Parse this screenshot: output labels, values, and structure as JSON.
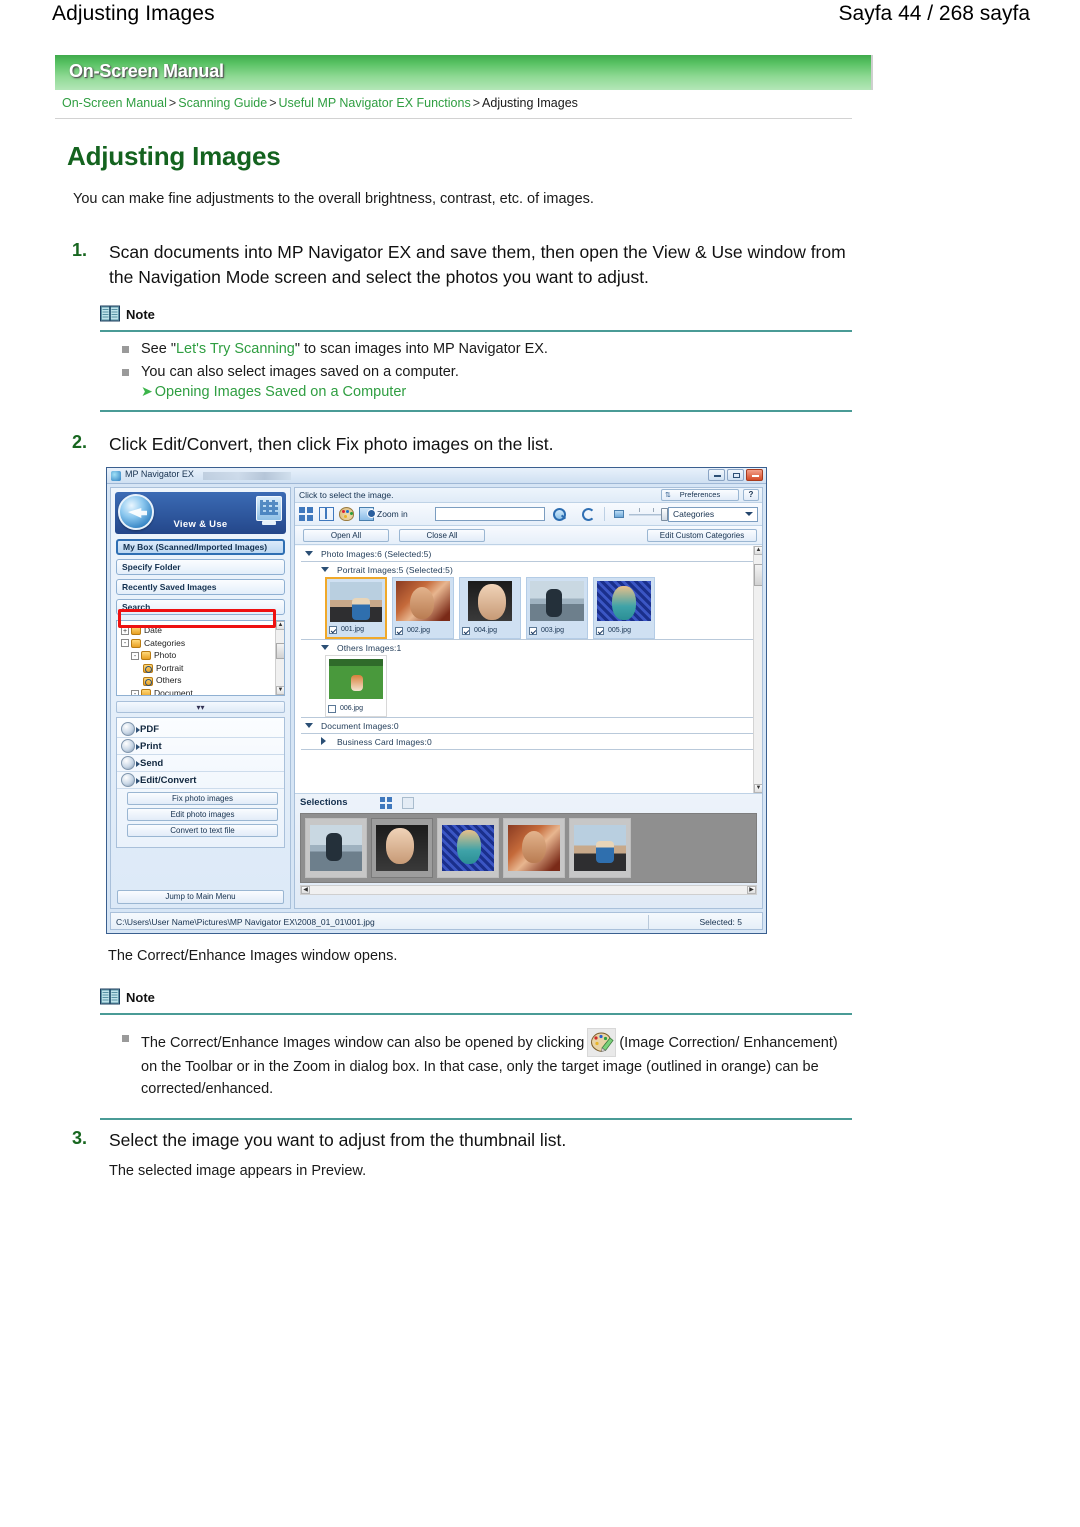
{
  "page_header": {
    "title": "Adjusting Images",
    "pagination": "Sayfa 44 / 268 sayfa"
  },
  "banner": {
    "label": "On-Screen Manual"
  },
  "breadcrumb": {
    "items": [
      "On-Screen Manual",
      "Scanning Guide",
      "Useful MP Navigator EX Functions",
      "Adjusting Images"
    ],
    "separator": ">"
  },
  "heading": "Adjusting Images",
  "intro": "You can make fine adjustments to the overall brightness, contrast, etc. of images.",
  "steps": [
    {
      "num": "1.",
      "text": "Scan documents into MP Navigator EX and save them, then open the View & Use window from the Navigation Mode screen and select the photos you want to adjust."
    },
    {
      "num": "2.",
      "text": "Click Edit/Convert, then click Fix photo images on the list."
    },
    {
      "num": "3.",
      "text": "Select the image you want to adjust from the thumbnail list."
    }
  ],
  "step3_sub": "The selected image appears in Preview.",
  "correct_opens": "The Correct/Enhance Images window opens.",
  "note1": {
    "label": "Note",
    "bullet1_pre": "See \"",
    "bullet1_link": "Let's Try Scanning",
    "bullet1_post": "\" to scan images into MP Navigator EX.",
    "bullet2": "You can also select images saved on a computer.",
    "link_arrow": "Opening Images Saved on a Computer"
  },
  "note2": {
    "label": "Note",
    "bullet_pre": "The Correct/Enhance Images window can also be opened by clicking",
    "bullet_post": "(Image Correction/ Enhancement) on the Toolbar or in the Zoom in dialog box. In that case, only the target image (outlined in orange) can be corrected/enhanced."
  },
  "app": {
    "title": "MP Navigator EX",
    "mode_label": "View & Use",
    "nav_buttons": [
      "My Box (Scanned/Imported Images)",
      "Specify Folder",
      "Recently Saved Images",
      "Search"
    ],
    "tree": [
      {
        "label": "Date",
        "indent": 0,
        "pm": "+",
        "icon": "folder"
      },
      {
        "label": "Categories",
        "indent": 0,
        "pm": "-",
        "icon": "folder"
      },
      {
        "label": "Photo",
        "indent": 1,
        "pm": "-",
        "icon": "folder"
      },
      {
        "label": "Portrait",
        "indent": 2,
        "pm": "",
        "icon": "search-folder"
      },
      {
        "label": "Others",
        "indent": 2,
        "pm": "",
        "icon": "search-folder"
      },
      {
        "label": "Document",
        "indent": 1,
        "pm": "-",
        "icon": "folder"
      }
    ],
    "menu": [
      {
        "label": "PDF"
      },
      {
        "label": "Print"
      },
      {
        "label": "Send"
      },
      {
        "label": "Edit/Convert"
      }
    ],
    "submenu": [
      "Fix photo images",
      "Edit photo images",
      "Convert to text file"
    ],
    "jump_button": "Jump to Main Menu",
    "hint": "Click to select the image.",
    "preferences_button": "Preferences",
    "help_button": "?",
    "zoom_in_label": "Zoom in",
    "search_value": "",
    "categories_select": "Categories",
    "open_all_button": "Open All",
    "close_all_button": "Close All",
    "edit_custom_categories_button": "Edit Custom Categories",
    "groups": [
      {
        "label": "Photo   Images:6   (Selected:5)",
        "indent": 0,
        "expanded": true
      },
      {
        "label": "Portrait   Images:5   (Selected:5)",
        "indent": 1,
        "expanded": true
      },
      {
        "label": "Others   Images:1",
        "indent": 1,
        "expanded": true
      },
      {
        "label": "Document   Images:0",
        "indent": 0,
        "expanded": true
      },
      {
        "label": "Business Card   Images:0",
        "indent": 1,
        "expanded": false
      }
    ],
    "portrait_thumbs": [
      {
        "name": "001.jpg",
        "checked": true,
        "active": true,
        "art": "ph1"
      },
      {
        "name": "002.jpg",
        "checked": true,
        "active": false,
        "art": "ph2"
      },
      {
        "name": "004.jpg",
        "checked": true,
        "active": false,
        "art": "ph3"
      },
      {
        "name": "003.jpg",
        "checked": true,
        "active": false,
        "art": "ph4"
      },
      {
        "name": "005.jpg",
        "checked": true,
        "active": false,
        "art": "ph5"
      }
    ],
    "others_thumbs": [
      {
        "name": "006.jpg",
        "checked": false,
        "active": false,
        "art": "ph6"
      }
    ],
    "selections_label": "Selections",
    "selection_thumbs": [
      "ph4",
      "ph3",
      "ph5",
      "ph2",
      "ph1"
    ],
    "status_path": "C:\\Users\\User Name\\Pictures\\MP Navigator EX\\2008_01_01\\001.jpg",
    "status_selected": "Selected: 5"
  },
  "colors": {
    "banner_green_dark": "#3faa4c",
    "banner_green_light": "#b4e6b8",
    "link_green": "#2f9e41",
    "heading_green": "#14631f",
    "note_rule": "#4a9b96",
    "highlight_red": "#ee1111",
    "active_thumb_orange": "#f0a92a"
  }
}
